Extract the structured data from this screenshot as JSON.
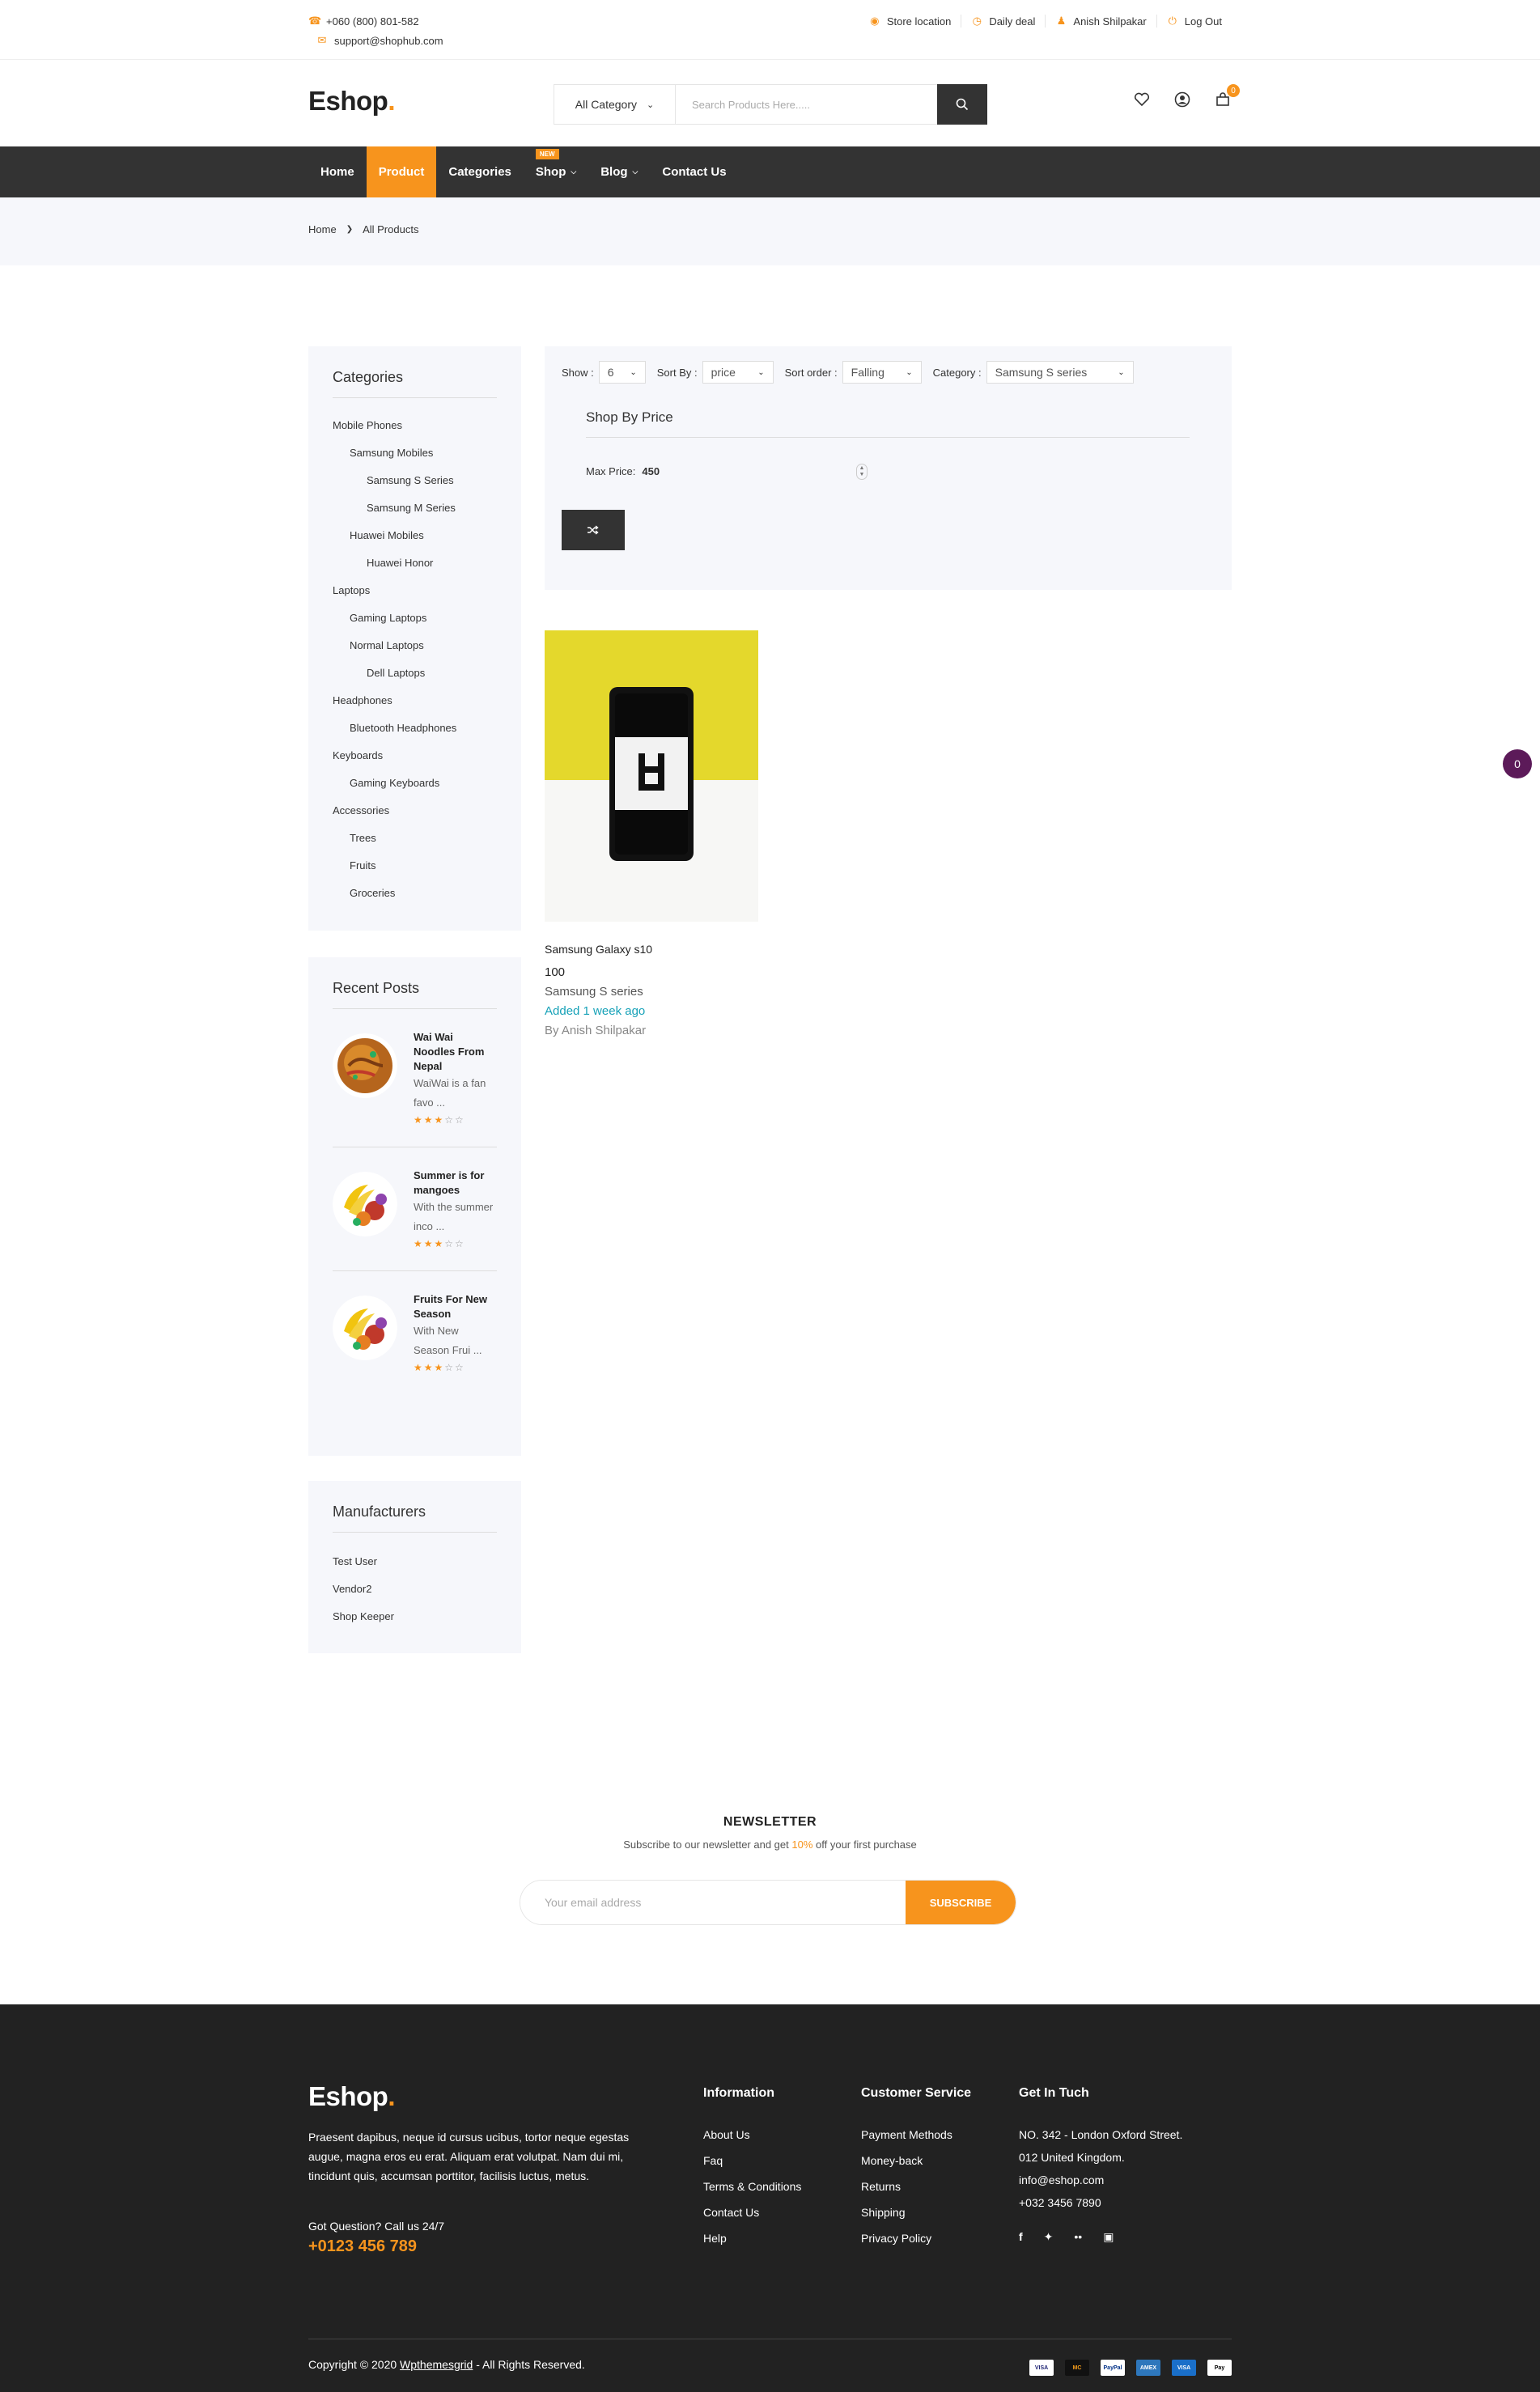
{
  "topbar": {
    "phone": "+060 (800) 801-582",
    "email": "support@shophub.com",
    "links": [
      "Store location",
      "Daily deal",
      "Anish Shilpakar",
      "Log Out"
    ]
  },
  "header": {
    "logo_text": "Eshop",
    "logo_dot": ".",
    "category_select": "All Category",
    "search_placeholder": "Search Products Here.....",
    "cart_count": "0"
  },
  "nav": {
    "items": [
      "Home",
      "Product",
      "Categories",
      "Shop",
      "Blog",
      "Contact Us"
    ],
    "new_badge": "NEW",
    "active": "Product"
  },
  "breadcrumb": {
    "home": "Home",
    "current": "All Products"
  },
  "sidebar": {
    "categories_title": "Categories",
    "categories": [
      "Mobile Phones",
      "Samsung Mobiles",
      "Samsung S Series",
      "Samsung M Series",
      "Huawei Mobiles",
      "Huawei Honor",
      "Laptops",
      "Gaming Laptops",
      "Normal Laptops",
      "Dell Laptops",
      "Headphones",
      "Bluetooth Headphones",
      "Keyboards",
      "Gaming Keyboards",
      "Accessories",
      "Trees",
      "Fruits",
      "Groceries"
    ],
    "recent_title": "Recent Posts",
    "posts": [
      {
        "title": "Wai Wai Noodles From Nepal",
        "excerpt": "WaiWai is a fan favo ..."
      },
      {
        "title": "Summer is for mangoes",
        "excerpt": "With the summer inco ..."
      },
      {
        "title": "Fruits For New Season",
        "excerpt": "With New Season Frui ..."
      }
    ],
    "manufacturers_title": "Manufacturers",
    "manufacturers": [
      "Test User",
      "Vendor2",
      "Shop Keeper"
    ]
  },
  "filter": {
    "show_label": "Show :",
    "show_value": "6",
    "sortby_label": "Sort By :",
    "sortby_value": "price",
    "sortorder_label": "Sort order :",
    "sortorder_value": "Falling",
    "category_label": "Category :",
    "category_value": "Samsung S series",
    "shop_by_price": "Shop By Price",
    "max_price_label": "Max Price:",
    "max_price_value": "450"
  },
  "product": {
    "name": "Samsung Galaxy s10",
    "price": "100",
    "category": "Samsung S series",
    "added": "Added 1 week ago",
    "by": "By Anish Shilpakar"
  },
  "floating_badge": "0",
  "newsletter": {
    "title": "NEWSLETTER",
    "sub_before": "Subscribe to our newsletter and get ",
    "sub_highlight": "10%",
    "sub_after": " off your first purchase",
    "placeholder": "Your email address",
    "button": "SUBSCRIBE"
  },
  "footer": {
    "logo_text": "Eshop",
    "description": "Praesent dapibus, neque id cursus ucibus, tortor neque egestas augue, magna eros eu erat. Aliquam erat volutpat. Nam dui mi, tincidunt quis, accumsan porttitor, facilisis luctus, metus.",
    "question": "Got Question? Call us 24/7",
    "phone": "+0123 456 789",
    "information_title": "Information",
    "information": [
      "About Us",
      "Faq",
      "Terms & Conditions",
      "Contact Us",
      "Help"
    ],
    "service_title": "Customer Service",
    "service": [
      "Payment Methods",
      "Money-back",
      "Returns",
      "Shipping",
      "Privacy Policy"
    ],
    "contact_title": "Get In Tuch",
    "contact": [
      "NO. 342 - London Oxford Street.",
      "012 United Kingdom.",
      "info@eshop.com",
      "+032 3456 7890"
    ],
    "copyright_before": "Copyright © 2020 ",
    "copyright_link": "Wpthemesgrid",
    "copyright_after": " -  All Rights Reserved.",
    "payments": [
      "VISA",
      "MC",
      "PayPal",
      "AMEX",
      "VISA",
      "Pay"
    ]
  }
}
